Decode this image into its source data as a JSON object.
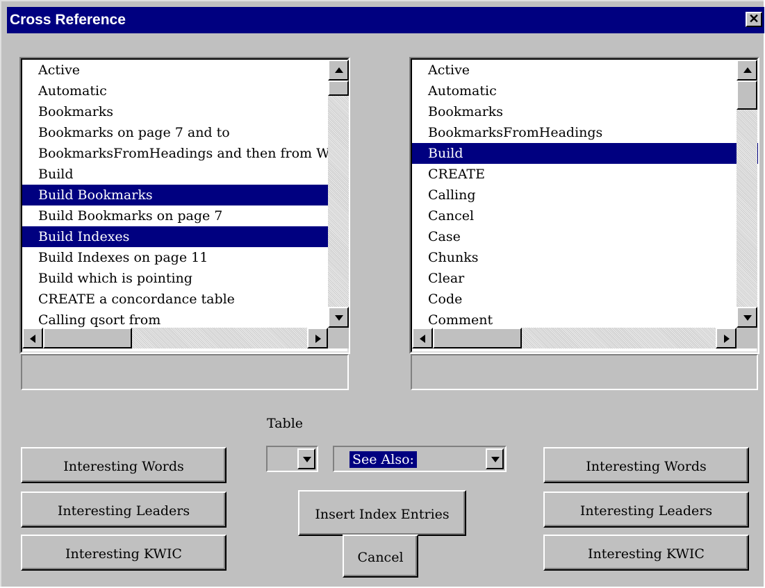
{
  "window": {
    "title": "Cross Reference",
    "close_glyph": "✕"
  },
  "left_list": {
    "items": [
      {
        "text": "Active",
        "selected": false
      },
      {
        "text": "Automatic",
        "selected": false
      },
      {
        "text": "Bookmarks",
        "selected": false
      },
      {
        "text": "Bookmarks on page 7 and to",
        "selected": false
      },
      {
        "text": "BookmarksFromHeadings and then from W",
        "selected": false
      },
      {
        "text": "Build",
        "selected": false
      },
      {
        "text": "Build Bookmarks",
        "selected": true
      },
      {
        "text": "Build Bookmarks on page 7",
        "selected": false
      },
      {
        "text": "Build Indexes",
        "selected": true
      },
      {
        "text": "Build Indexes on page 11",
        "selected": false
      },
      {
        "text": "Build which is pointing",
        "selected": false
      },
      {
        "text": "CREATE a concordance table",
        "selected": false
      },
      {
        "text": "Calling qsort from",
        "selected": false
      }
    ],
    "status_text": ""
  },
  "right_list": {
    "items": [
      {
        "text": "Active",
        "selected": false
      },
      {
        "text": "Automatic",
        "selected": false
      },
      {
        "text": "Bookmarks",
        "selected": false
      },
      {
        "text": "BookmarksFromHeadings",
        "selected": false
      },
      {
        "text": "Build",
        "selected": true
      },
      {
        "text": "CREATE",
        "selected": false
      },
      {
        "text": "Calling",
        "selected": false
      },
      {
        "text": "Cancel",
        "selected": false
      },
      {
        "text": "Case",
        "selected": false
      },
      {
        "text": "Chunks",
        "selected": false
      },
      {
        "text": "Clear",
        "selected": false
      },
      {
        "text": "Code",
        "selected": false
      },
      {
        "text": "Comment",
        "selected": false
      }
    ],
    "status_text": ""
  },
  "table_label": "Table",
  "table_combo": {
    "value": ""
  },
  "see_also_combo": {
    "value": "See Also:"
  },
  "left_buttons": {
    "words": "Interesting Words",
    "leaders": "Interesting Leaders",
    "kwic": "Interesting KWIC"
  },
  "right_buttons": {
    "words": "Interesting Words",
    "leaders": "Interesting Leaders",
    "kwic": "Interesting KWIC"
  },
  "center_buttons": {
    "insert": "Insert Index Entries",
    "cancel": "Cancel"
  },
  "colors": {
    "titlebar": "#000080",
    "face": "#c0c0c0",
    "selection": "#000080"
  }
}
